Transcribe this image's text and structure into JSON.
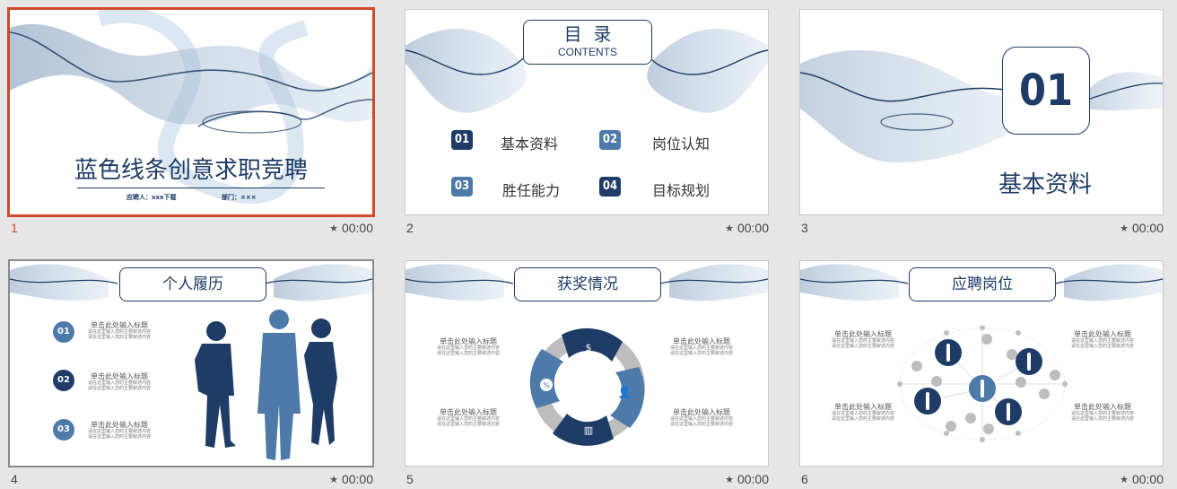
{
  "slides": [
    {
      "number": "1",
      "time": "00:00",
      "selected": true,
      "title": "蓝色线条创意求职竞聘",
      "applicant": "应聘人：xxx下载",
      "department": "部门：×××"
    },
    {
      "number": "2",
      "time": "00:00",
      "title": "目  录",
      "subtitle": "CONTENTS",
      "items": [
        {
          "badge": "01",
          "label": "基本资料"
        },
        {
          "badge": "02",
          "label": "岗位认知"
        },
        {
          "badge": "03",
          "label": "胜任能力"
        },
        {
          "badge": "04",
          "label": "目标规划"
        }
      ]
    },
    {
      "number": "3",
      "time": "00:00",
      "badge": "01",
      "title": "基本资料"
    },
    {
      "number": "4",
      "time": "00:00",
      "title": "个人履历",
      "items": [
        {
          "badge": "01",
          "title": "单击此处输入标题",
          "line1": "请在这里输入您的主要叙述内容",
          "line2": "请在这里输入您的主要叙述内容"
        },
        {
          "badge": "02",
          "title": "单击此处输入标题",
          "line1": "请在这里输入您的主要叙述内容",
          "line2": "请在这里输入您的主要叙述内容"
        },
        {
          "badge": "03",
          "title": "单击此处输入标题",
          "line1": "请在这里输入您的主要叙述内容",
          "line2": "请在这里输入您的主要叙述内容"
        }
      ]
    },
    {
      "number": "5",
      "time": "00:00",
      "title": "获奖情况",
      "items": [
        {
          "title": "单击此处输入标题",
          "line1": "请在这里输入您的主要叙述内容",
          "line2": "请在这里输入您的主要叙述内容"
        },
        {
          "title": "单击此处输入标题",
          "line1": "请在这里输入您的主要叙述内容",
          "line2": "请在这里输入您的主要叙述内容"
        },
        {
          "title": "单击此处输入标题",
          "line1": "请在这里输入您的主要叙述内容",
          "line2": "请在这里输入您的主要叙述内容"
        },
        {
          "title": "单击此处输入标题",
          "line1": "请在这里输入您的主要叙述内容",
          "line2": "请在这里输入您的主要叙述内容"
        }
      ],
      "ring_icons": [
        "money-icon",
        "user-icon",
        "bars-icon",
        "percent-icon"
      ]
    },
    {
      "number": "6",
      "time": "00:00",
      "title": "应聘岗位",
      "items": [
        {
          "title": "单击此处输入标题",
          "line1": "请在这里输入您的主要叙述内容",
          "line2": "请在这里输入您的主要叙述内容"
        },
        {
          "title": "单击此处输入标题",
          "line1": "请在这里输入您的主要叙述内容",
          "line2": "请在这里输入您的主要叙述内容"
        },
        {
          "title": "单击此处输入标题",
          "line1": "请在这里输入您的主要叙述内容",
          "line2": "请在这里输入您的主要叙述内容"
        },
        {
          "title": "单击此处输入标题",
          "line1": "请在这里输入您的主要叙述内容",
          "line2": "请在这里输入您的主要叙述内容"
        }
      ]
    }
  ],
  "colors": {
    "navy": "#1e3c66",
    "light_blue": "#4e7aaa",
    "selection": "#d04a2a",
    "gray_ring": "#bdbdbd"
  }
}
